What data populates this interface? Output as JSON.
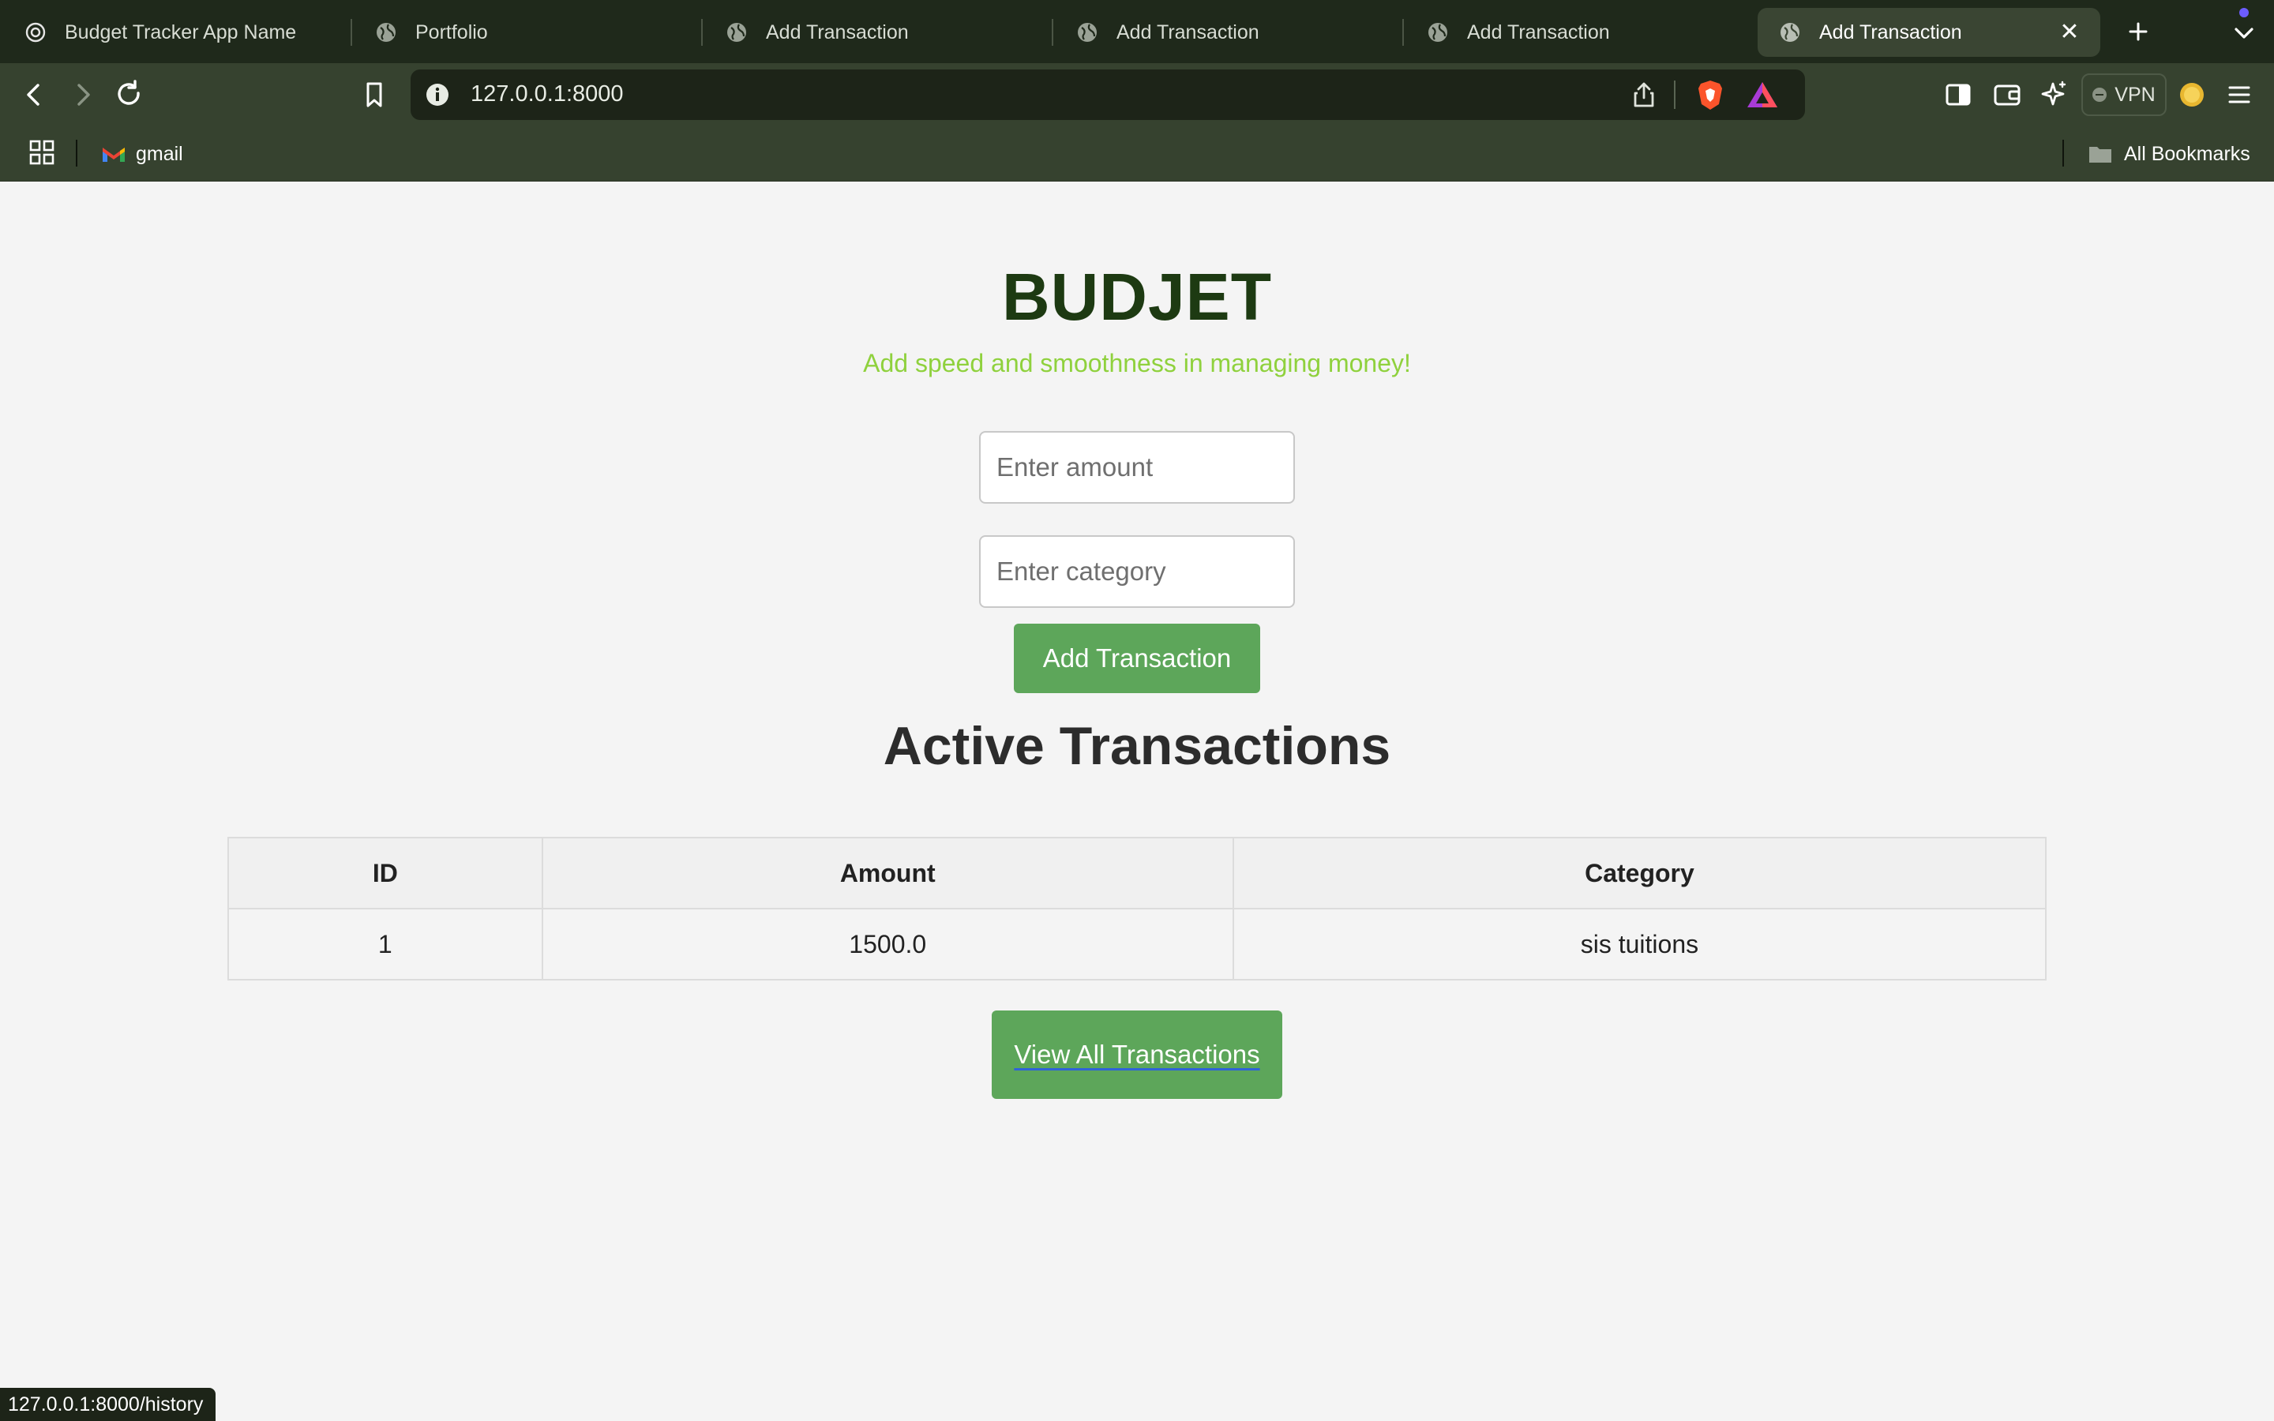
{
  "browser": {
    "tabs": [
      {
        "title": "Budget Tracker App Name",
        "icon": "openai-icon",
        "active": false
      },
      {
        "title": "Portfolio",
        "icon": "globe-icon",
        "active": false
      },
      {
        "title": "Add Transaction",
        "icon": "globe-icon",
        "active": false
      },
      {
        "title": "Add Transaction",
        "icon": "globe-icon",
        "active": false
      },
      {
        "title": "Add Transaction",
        "icon": "globe-icon",
        "active": false
      },
      {
        "title": "Add Transaction",
        "icon": "globe-icon",
        "active": true
      }
    ],
    "close_glyph": "✕",
    "url": "127.0.0.1:8000",
    "vpn_label": "VPN",
    "bookmarks": {
      "gmail_label": "gmail",
      "all_label": "All Bookmarks"
    },
    "status_url": "127.0.0.1:8000/history"
  },
  "page": {
    "title": "BUDJET",
    "subtitle": "Add speed and smoothness in managing money!",
    "amount_placeholder": "Enter amount",
    "amount_value": "",
    "category_placeholder": "Enter category",
    "category_value": "",
    "add_button": "Add Transaction",
    "section_title": "Active Transactions",
    "table": {
      "headers": [
        "ID",
        "Amount",
        "Category"
      ],
      "rows": [
        [
          "1",
          "1500.0",
          "sis tuitions"
        ]
      ]
    },
    "view_all_button": "View All Transactions"
  },
  "colors": {
    "title": "#1d3a12",
    "subtitle": "#8fd13d",
    "button": "#5da65a",
    "chrome_dark": "#1f291b",
    "chrome_toolbar": "#36422f"
  }
}
